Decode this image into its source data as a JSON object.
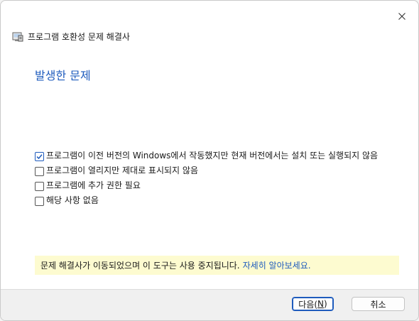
{
  "window": {
    "title": "프로그램 호환성 문제 해결사",
    "icons": {
      "app": "compatibility-troubleshooter-icon",
      "close": "close-icon"
    }
  },
  "page": {
    "heading": "발생한 문제"
  },
  "options": [
    {
      "label": "프로그램이 이전 버전의 Windows에서 작동했지만 현재 버전에서는 설치 또는 실행되지 않음",
      "checked": true
    },
    {
      "label": "프로그램이 열리지만 제대로 표시되지 않음",
      "checked": false
    },
    {
      "label": "프로그램에 추가 권한 필요",
      "checked": false
    },
    {
      "label": "해당 사항 없음",
      "checked": false
    }
  ],
  "notice": {
    "text": "문제 해결사가 이동되었으며 이 도구는 사용 중지됩니다.",
    "link": "자세히 알아보세요."
  },
  "footer": {
    "next_label_pre": "다음(",
    "next_label_key": "N",
    "next_label_post": ")",
    "cancel_label": "취소"
  },
  "colors": {
    "accent": "#1e5bbd",
    "notice_bg": "#fdfbd0",
    "footer_bg": "#f0f0f0"
  }
}
